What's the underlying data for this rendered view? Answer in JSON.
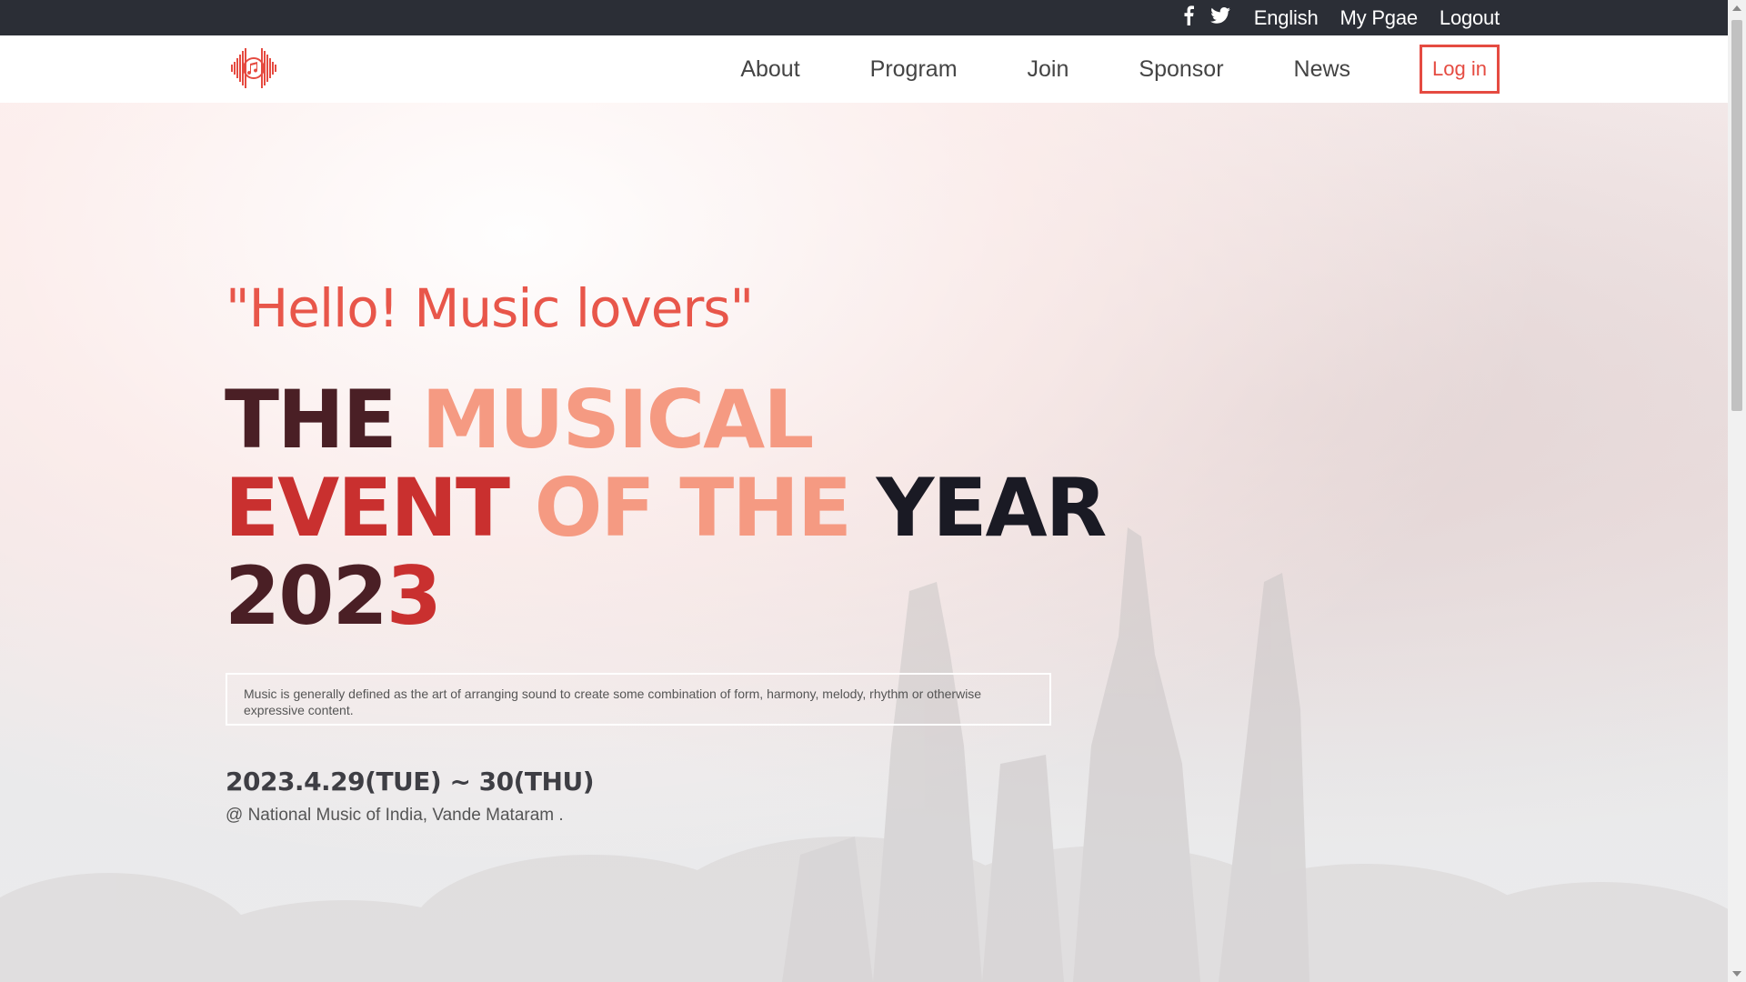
{
  "topbar": {
    "links": [
      "English",
      "My Pgae",
      "Logout"
    ],
    "social_icons": [
      "facebook-icon",
      "twitter-icon"
    ]
  },
  "nav": {
    "items": [
      "About",
      "Program",
      "Join",
      "Sponsor",
      "News"
    ],
    "login": "Log in",
    "logo_icon": "music-note-icon"
  },
  "hero": {
    "subtitle": "\"Hello! Music lovers\"",
    "title_line1": {
      "a": "THE ",
      "b": "MUSICAL"
    },
    "title_line2": {
      "a": "EVENT ",
      "b": "OF THE ",
      "c": "YEA",
      "d": "R"
    },
    "title_line3": {
      "a": "202",
      "b": "3"
    },
    "description": "Music is generally defined as the art of arranging sound to create some combination of form, harmony, melody, rhythm or otherwise expressive content.",
    "date": "2023.4.29(TUE) ~ 30(THU)",
    "venue": "@ National Music of India, Vande Mataram ."
  },
  "colors": {
    "accent": "#e54b41",
    "topbar_bg": "#2b2e36",
    "title_dark": "#4a1f25",
    "title_salmon": "#f59a82",
    "title_black": "#1a1a24"
  }
}
